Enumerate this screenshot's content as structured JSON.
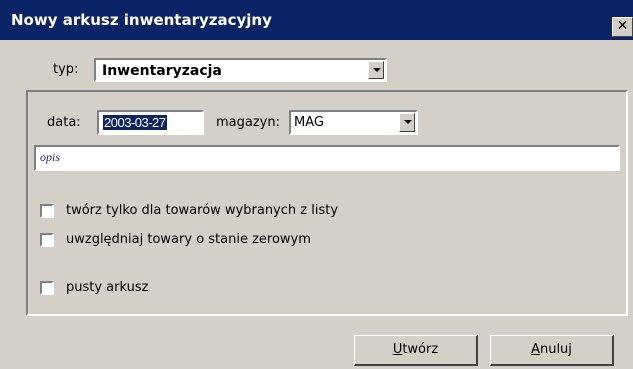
{
  "window": {
    "title": "Nowy arkusz inwentaryzacyjny",
    "close_glyph": "✕"
  },
  "typ": {
    "label": "typ:",
    "value": "Inwentaryzacja"
  },
  "data": {
    "label": "data:",
    "value": "2003-03-27"
  },
  "magazyn": {
    "label": "magazyn:",
    "value": "MAG"
  },
  "opis": {
    "value": "opis"
  },
  "checkboxes": [
    {
      "label": "twórz tylko dla towarów wybranych z listy",
      "checked": false
    },
    {
      "label": "uwzględniaj towary o stanie zerowym",
      "checked": false
    },
    {
      "label": "pusty arkusz",
      "checked": false
    }
  ],
  "buttons": {
    "create_mnemonic": "U",
    "create_rest": "twórz",
    "cancel_mnemonic": "A",
    "cancel_rest": "nuluj"
  },
  "colors": {
    "titlebar": "#0a2466",
    "window_bg": "#d4d0c8",
    "selection": "#0a2466"
  }
}
